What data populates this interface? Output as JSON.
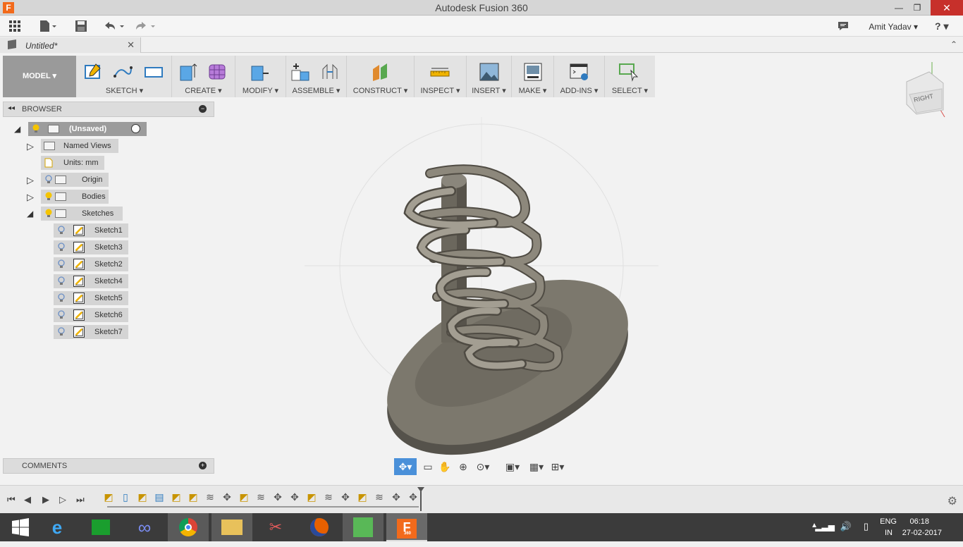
{
  "window": {
    "title": "Autodesk Fusion 360",
    "minimize": "—",
    "maximize": "❐",
    "close": "✕"
  },
  "qat": {
    "user": "Amit Yadav ▾",
    "help": "? ▾"
  },
  "tab": {
    "name": "Untitled*",
    "close": "✕",
    "collapse": "⌃"
  },
  "toolbar": {
    "workspace": "MODEL ▾",
    "groups": [
      {
        "label": "SKETCH ▾"
      },
      {
        "label": "CREATE ▾"
      },
      {
        "label": "MODIFY ▾"
      },
      {
        "label": "ASSEMBLE ▾"
      },
      {
        "label": "CONSTRUCT ▾"
      },
      {
        "label": "INSPECT ▾"
      },
      {
        "label": "INSERT ▾"
      },
      {
        "label": "MAKE ▾"
      },
      {
        "label": "ADD-INS ▾"
      },
      {
        "label": "SELECT ▾"
      }
    ]
  },
  "browser": {
    "title": "BROWSER",
    "root": "(Unsaved)",
    "items": [
      {
        "label": "Named Views"
      },
      {
        "label": "Units: mm"
      },
      {
        "label": "Origin"
      },
      {
        "label": "Bodies"
      },
      {
        "label": "Sketches"
      }
    ],
    "sketches": [
      "Sketch1",
      "Sketch3",
      "Sketch2",
      "Sketch4",
      "Sketch5",
      "Sketch6",
      "Sketch7"
    ]
  },
  "comments": {
    "title": "COMMENTS"
  },
  "viewcube": {
    "face": "RIGHT"
  },
  "taskbar": {
    "lang_top": "ENG",
    "lang_bottom": "IN",
    "time": "06:18",
    "date": "27-02-2017",
    "fusion_label": "360"
  },
  "colors": {
    "accent": "#4a90d9",
    "model_fill": "#6f6a5f",
    "close_red": "#c7302b"
  }
}
